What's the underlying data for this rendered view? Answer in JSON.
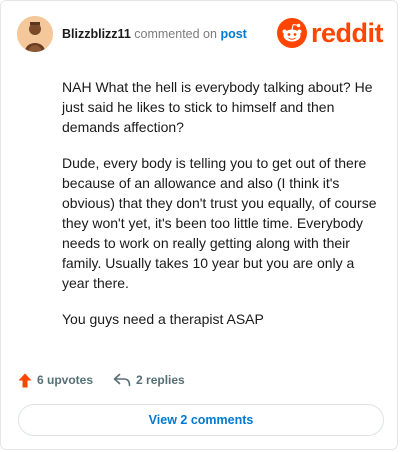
{
  "comment": {
    "username": "Blizzblizz11",
    "action_text": "commented on",
    "post_link": "post",
    "paragraphs": [
      "NAH What the hell is everybody talking about? He just said he likes to stick to himself and then demands affection?",
      "Dude, every body is telling you to get out of there because of an allowance and also (I think it's obvious) that they don't trust you equally, of course they won't yet, it's been too little time. Everybody needs to work on really getting along with their family. Usually takes 10 year but you are only a year there.",
      "You guys need a therapist ASAP"
    ]
  },
  "brand": {
    "wordmark": "reddit",
    "color": "#ff4500",
    "icon": "reddit-snoo-icon"
  },
  "actions": {
    "upvotes": "6 upvotes",
    "replies": "2 replies",
    "upvote_icon": "upvote-arrow-icon",
    "reply_icon": "reply-arrow-icon",
    "upvote_color": "#ff4500"
  },
  "footer": {
    "view_comments": "View 2 comments"
  },
  "colors": {
    "link": "#0079d3",
    "muted": "#7c7c7c"
  }
}
